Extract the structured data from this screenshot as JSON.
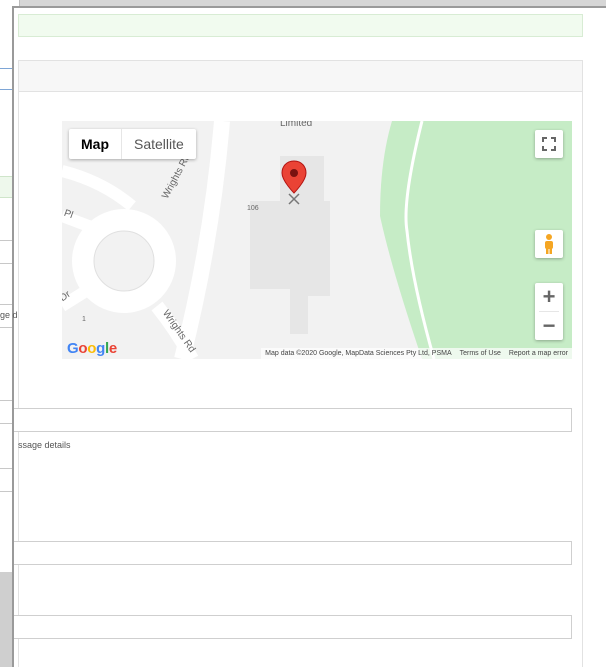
{
  "bg_window": {
    "text_1": "ge d",
    "text_2": "ssage details"
  },
  "map": {
    "type_controls": [
      {
        "label": "Map",
        "active": true
      },
      {
        "label": "Satellite",
        "active": false
      }
    ],
    "road_labels": [
      "Wrights Rd",
      "Wrights Rd",
      "Limited",
      "106",
      "Pl",
      "Dr",
      "1"
    ],
    "google_logo": "Google",
    "attribution": {
      "data": "Map data ©2020 Google, MapData Sciences Pty Ltd, PSMA",
      "terms": "Terms of Use",
      "report": "Report a map error"
    },
    "zoom_in": "+",
    "zoom_out": "−",
    "colors": {
      "park": "#c6ecc6",
      "road": "#ffffff",
      "building": "#e6e6e6",
      "pin": "#ea4335"
    }
  },
  "form": {
    "message_details_help": "ssage details"
  }
}
